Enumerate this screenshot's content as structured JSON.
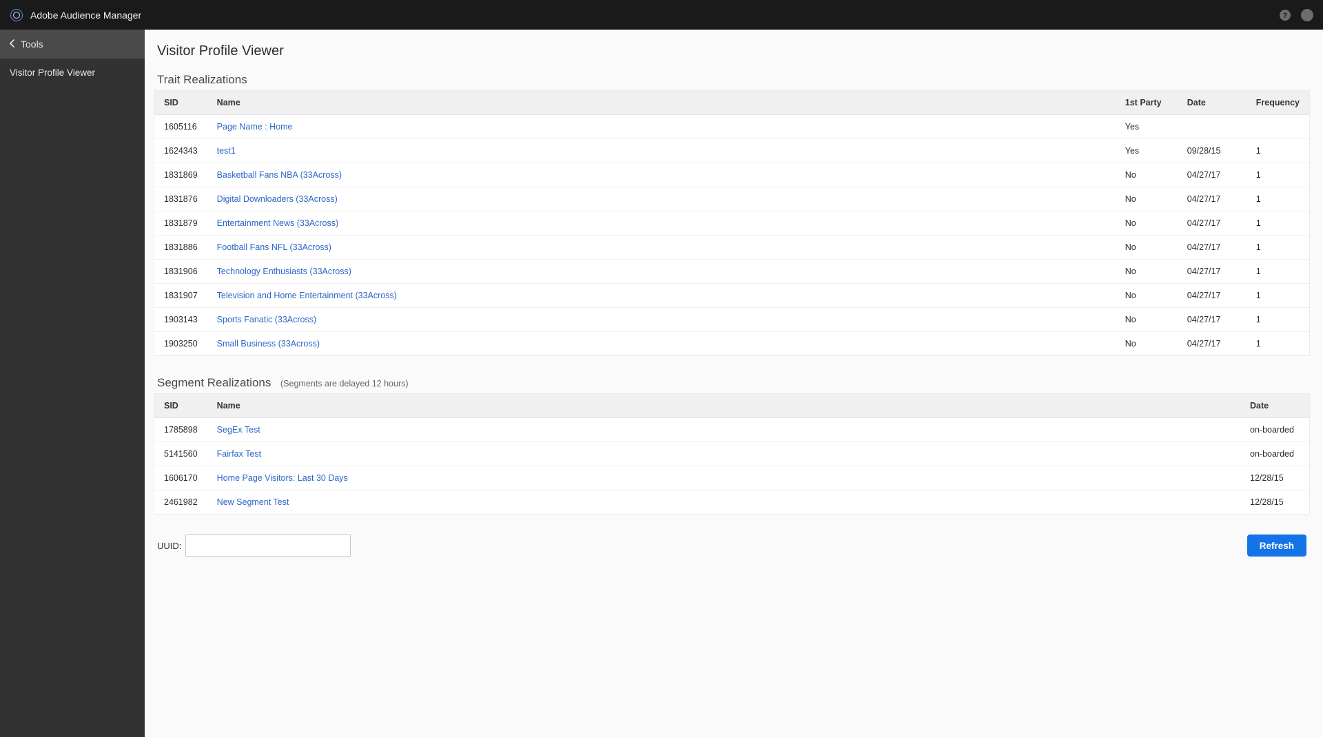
{
  "app": {
    "title": "Adobe Audience Manager"
  },
  "sidebar": {
    "back_label": "Tools",
    "items": [
      {
        "label": "Visitor Profile Viewer"
      }
    ]
  },
  "page": {
    "title": "Visitor Profile Viewer",
    "traits_title": "Trait Realizations",
    "segments_title": "Segment Realizations",
    "segments_note": "(Segments are delayed 12 hours)",
    "uuid_label": "UUID:",
    "uuid_value": "",
    "refresh_label": "Refresh"
  },
  "traits": {
    "columns": {
      "sid": "SID",
      "name": "Name",
      "party": "1st Party",
      "date": "Date",
      "freq": "Frequency"
    },
    "rows": [
      {
        "sid": "1605116",
        "name": "Page Name : Home",
        "party": "Yes",
        "date": "",
        "freq": ""
      },
      {
        "sid": "1624343",
        "name": "test1",
        "party": "Yes",
        "date": "09/28/15",
        "freq": "1"
      },
      {
        "sid": "1831869",
        "name": "Basketball Fans NBA (33Across)",
        "party": "No",
        "date": "04/27/17",
        "freq": "1"
      },
      {
        "sid": "1831876",
        "name": "Digital Downloaders (33Across)",
        "party": "No",
        "date": "04/27/17",
        "freq": "1"
      },
      {
        "sid": "1831879",
        "name": "Entertainment News (33Across)",
        "party": "No",
        "date": "04/27/17",
        "freq": "1"
      },
      {
        "sid": "1831886",
        "name": "Football Fans NFL (33Across)",
        "party": "No",
        "date": "04/27/17",
        "freq": "1"
      },
      {
        "sid": "1831906",
        "name": "Technology Enthusiasts (33Across)",
        "party": "No",
        "date": "04/27/17",
        "freq": "1"
      },
      {
        "sid": "1831907",
        "name": "Television and Home Entertainment (33Across)",
        "party": "No",
        "date": "04/27/17",
        "freq": "1"
      },
      {
        "sid": "1903143",
        "name": "Sports Fanatic (33Across)",
        "party": "No",
        "date": "04/27/17",
        "freq": "1"
      },
      {
        "sid": "1903250",
        "name": "Small Business (33Across)",
        "party": "No",
        "date": "04/27/17",
        "freq": "1"
      }
    ]
  },
  "segments": {
    "columns": {
      "sid": "SID",
      "name": "Name",
      "date": "Date"
    },
    "rows": [
      {
        "sid": "1785898",
        "name": "SegEx Test",
        "date": "on-boarded"
      },
      {
        "sid": "5141560",
        "name": "Fairfax Test",
        "date": "on-boarded"
      },
      {
        "sid": "1606170",
        "name": "Home Page Visitors: Last 30 Days",
        "date": "12/28/15"
      },
      {
        "sid": "2461982",
        "name": "New Segment Test",
        "date": "12/28/15"
      }
    ]
  }
}
